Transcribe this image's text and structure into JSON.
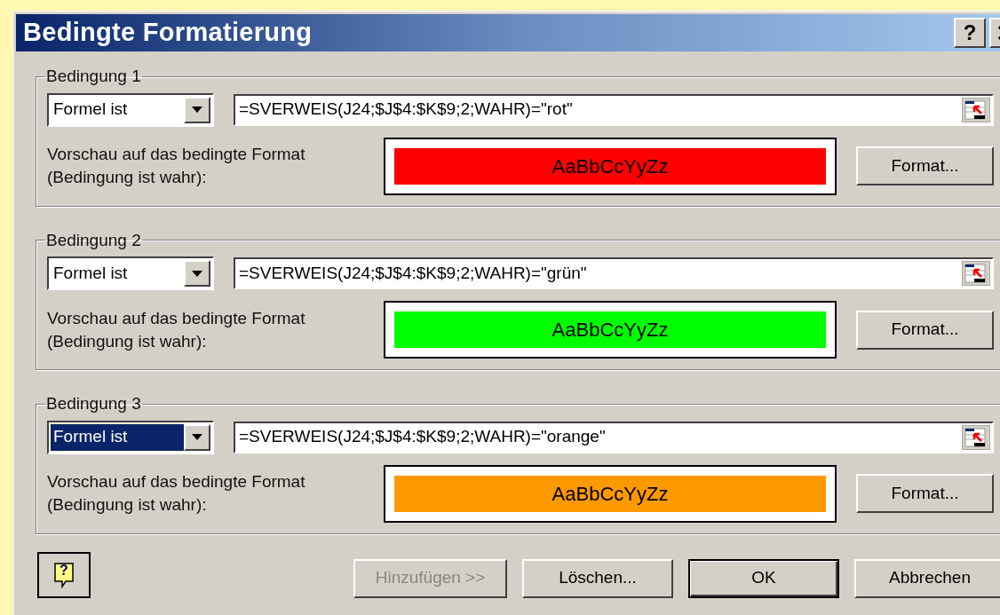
{
  "window": {
    "title": "Bedingte Formatierung",
    "help_button": "?"
  },
  "conditions": [
    {
      "label": "Bedingung 1",
      "operator": {
        "value": "Formel ist",
        "focused": false
      },
      "formula": "=SVERWEIS(J24;$J$4:$K$9;2;WAHR)=\"rot\"",
      "preview_label": "Vorschau auf das bedingte Format\n(Bedingung ist wahr):",
      "preview": {
        "sample": "AaBbCcYyZz",
        "color": "#ff0000"
      },
      "format_button": "Format..."
    },
    {
      "label": "Bedingung 2",
      "operator": {
        "value": "Formel ist",
        "focused": false
      },
      "formula": "=SVERWEIS(J24;$J$4:$K$9;2;WAHR)=\"grün\"",
      "preview_label": "Vorschau auf das bedingte Format\n(Bedingung ist wahr):",
      "preview": {
        "sample": "AaBbCcYyZz",
        "color": "#00ff00"
      },
      "format_button": "Format..."
    },
    {
      "label": "Bedingung 3",
      "operator": {
        "value": "Formel ist",
        "focused": true
      },
      "formula": "=SVERWEIS(J24;$J$4:$K$9;2;WAHR)=\"orange\"",
      "preview_label": "Vorschau auf das bedingte Format\n(Bedingung ist wahr):",
      "preview": {
        "sample": "AaBbCcYyZz",
        "color": "#ff9900"
      },
      "format_button": "Format..."
    }
  ],
  "footer": {
    "buttons": [
      {
        "kind": "icon",
        "label": "?",
        "disabled": false
      },
      {
        "kind": "text",
        "label": "Hinzufügen >>",
        "disabled": true,
        "default": false
      },
      {
        "kind": "text",
        "label": "Löschen...",
        "disabled": false,
        "default": false
      },
      {
        "kind": "text",
        "label": "OK",
        "disabled": false,
        "default": true
      },
      {
        "kind": "text",
        "label": "Abbrechen",
        "disabled": false,
        "default": false
      }
    ]
  }
}
